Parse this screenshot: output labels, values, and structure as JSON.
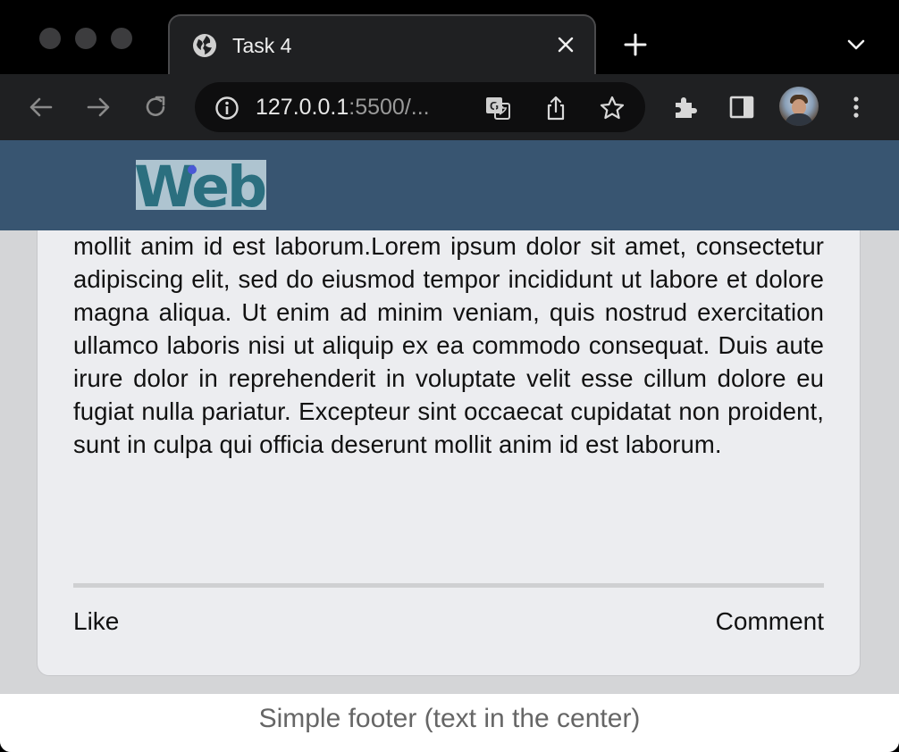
{
  "browser": {
    "tab": {
      "title": "Task 4",
      "favicon": "globe-icon"
    },
    "address": {
      "host": "127.0.0.1",
      "rest": ":5500/..."
    },
    "icons": [
      "back-icon",
      "forward-icon",
      "reload-icon",
      "info-icon",
      "translate-icon",
      "share-icon",
      "star-icon",
      "extensions-icon",
      "sidepanel-icon",
      "menu-icon"
    ]
  },
  "page": {
    "logo": "Web",
    "post": {
      "text": "occaecat cupidatat non proident, sunt in culpa qui officia deserunt mollit anim id est laborum.Lorem ipsum dolor sit amet, consectetur adipiscing elit, sed do eiusmod tempor incididunt ut labore et dolore magna aliqua. Ut enim ad minim veniam, quis nostrud exercitation ullamco laboris nisi ut aliquip ex ea commodo consequat. Duis aute irure dolor in reprehenderit in voluptate velit esse cillum dolore eu fugiat nulla pariatur. Excepteur sint occaecat cupidatat non proident, sunt in culpa qui officia deserunt mollit anim id est laborum.",
      "like_label": "Like",
      "comment_label": "Comment"
    },
    "footer": "Simple footer (text in the center)"
  },
  "colors": {
    "header": "#385571",
    "card": "#ecedf0",
    "page_bg": "#d4d5d7"
  }
}
